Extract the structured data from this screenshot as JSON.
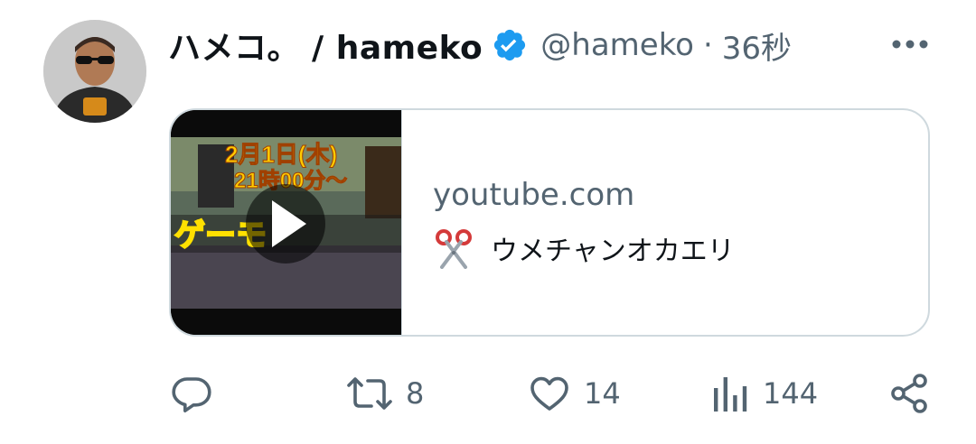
{
  "tweet": {
    "display_name": "ハメコ。 / hameko",
    "handle": "@hameko",
    "separator": "·",
    "time": "36秒",
    "verified": true
  },
  "card": {
    "domain": "youtube.com",
    "title": "ウメチャンオカエリ",
    "title_emoji": "scissors-emoji",
    "thumbnail": {
      "date_text": "2月1日(木)",
      "time_text": "21時00分〜",
      "overlay_text": "ゲーモ",
      "has_play_button": true
    }
  },
  "actions": {
    "reply_count": "",
    "retweet_count": "8",
    "like_count": "14",
    "views_count": "144"
  },
  "colors": {
    "verified_blue": "#1d9bf0",
    "muted_text": "#536471",
    "border": "#cfd9de"
  }
}
